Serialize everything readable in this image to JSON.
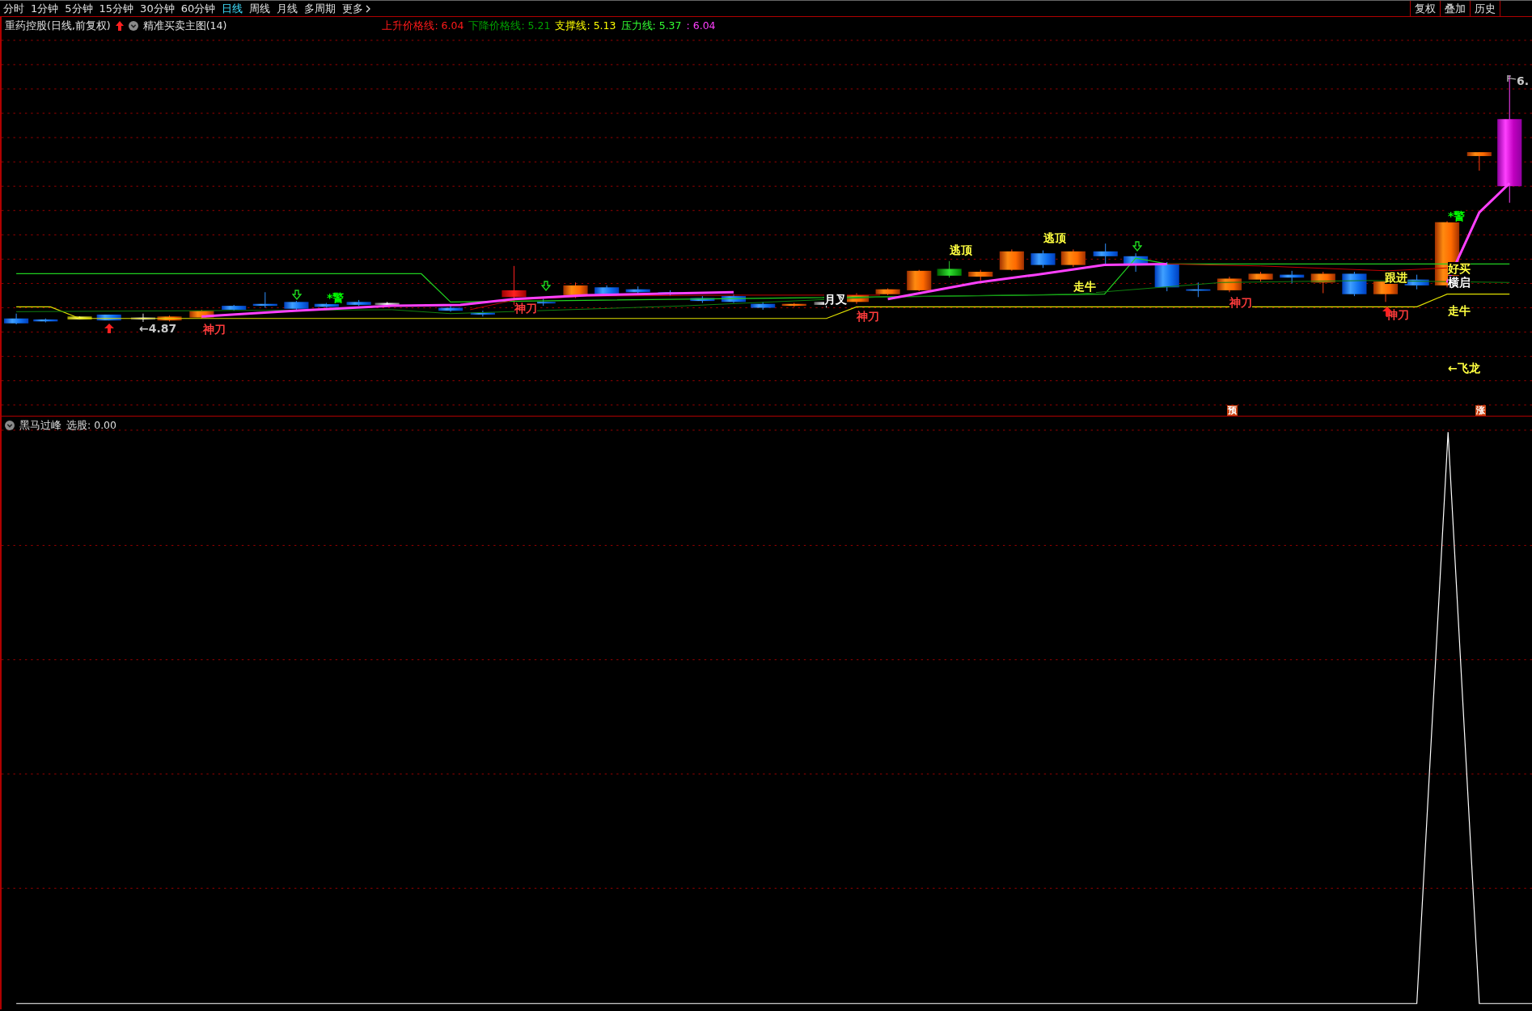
{
  "toolbar": {
    "periods": [
      {
        "label": "分时",
        "selected": false
      },
      {
        "label": "1分钟",
        "selected": false
      },
      {
        "label": "5分钟",
        "selected": false
      },
      {
        "label": "15分钟",
        "selected": false
      },
      {
        "label": "30分钟",
        "selected": false
      },
      {
        "label": "60分钟",
        "selected": false
      },
      {
        "label": "日线",
        "selected": true
      },
      {
        "label": "周线",
        "selected": false
      },
      {
        "label": "月线",
        "selected": false
      },
      {
        "label": "多周期",
        "selected": false
      }
    ],
    "more": "更多",
    "buttons": [
      "复权",
      "叠加",
      "历史"
    ]
  },
  "main_chart": {
    "security": "重药控股(日线,前复权)",
    "indicator": "精准买卖主图(14)",
    "legend": [
      {
        "label": "上升价格线:",
        "value": "6.04",
        "color": "#ff1a1a"
      },
      {
        "label": "下降价格线:",
        "value": "5.21",
        "color": "#00a000"
      },
      {
        "label": "支撑线:",
        "value": "5.13",
        "color": "#ffff00"
      },
      {
        "label": "压力线:",
        "value": "5.37",
        "color": "#33ff33"
      },
      {
        "value": ": 6.04",
        "color": "#ff40ff"
      }
    ],
    "annotations": [
      {
        "text": "←4.87",
        "color": "#c8c8c8",
        "kind": "label"
      },
      {
        "text": "神刀",
        "color": "#ff3c3c",
        "kind": "label"
      },
      {
        "text": "*警",
        "color": "#00ff00",
        "kind": "label"
      },
      {
        "text": "神刀",
        "color": "#ff3c3c",
        "kind": "label"
      },
      {
        "text": "月叉",
        "color": "#ffffff",
        "kind": "label"
      },
      {
        "text": "神刀",
        "color": "#ff3c3c",
        "kind": "label"
      },
      {
        "text": "逃顶",
        "color": "#ffff40",
        "kind": "label"
      },
      {
        "text": "逃顶",
        "color": "#ffff40",
        "kind": "label"
      },
      {
        "text": "走牛",
        "color": "#ffff40",
        "kind": "label"
      },
      {
        "text": "神刀",
        "color": "#ff3c3c",
        "kind": "label"
      },
      {
        "text": "跟进",
        "color": "#ffff40",
        "kind": "label"
      },
      {
        "text": "神刀",
        "color": "#ff3c3c",
        "kind": "label"
      },
      {
        "text": "*警",
        "color": "#00ff00",
        "kind": "label"
      },
      {
        "text": "好买",
        "color": "#ffff40",
        "kind": "label"
      },
      {
        "text": "横启",
        "color": "#ffffff",
        "kind": "label"
      },
      {
        "text": "走牛",
        "color": "#ffff40",
        "kind": "label"
      },
      {
        "text": "←飞龙",
        "color": "#ffff40",
        "kind": "label"
      },
      {
        "text": "预",
        "color": "#c84010",
        "kind": "tag"
      },
      {
        "text": "涨",
        "color": "#c84010",
        "kind": "tag"
      },
      {
        "text": "6.",
        "color": "#c8c8c8",
        "kind": "label"
      }
    ]
  },
  "sub_chart": {
    "indicator": "黑马过峰",
    "legend_label": "选股:",
    "value": "0.00"
  }
}
